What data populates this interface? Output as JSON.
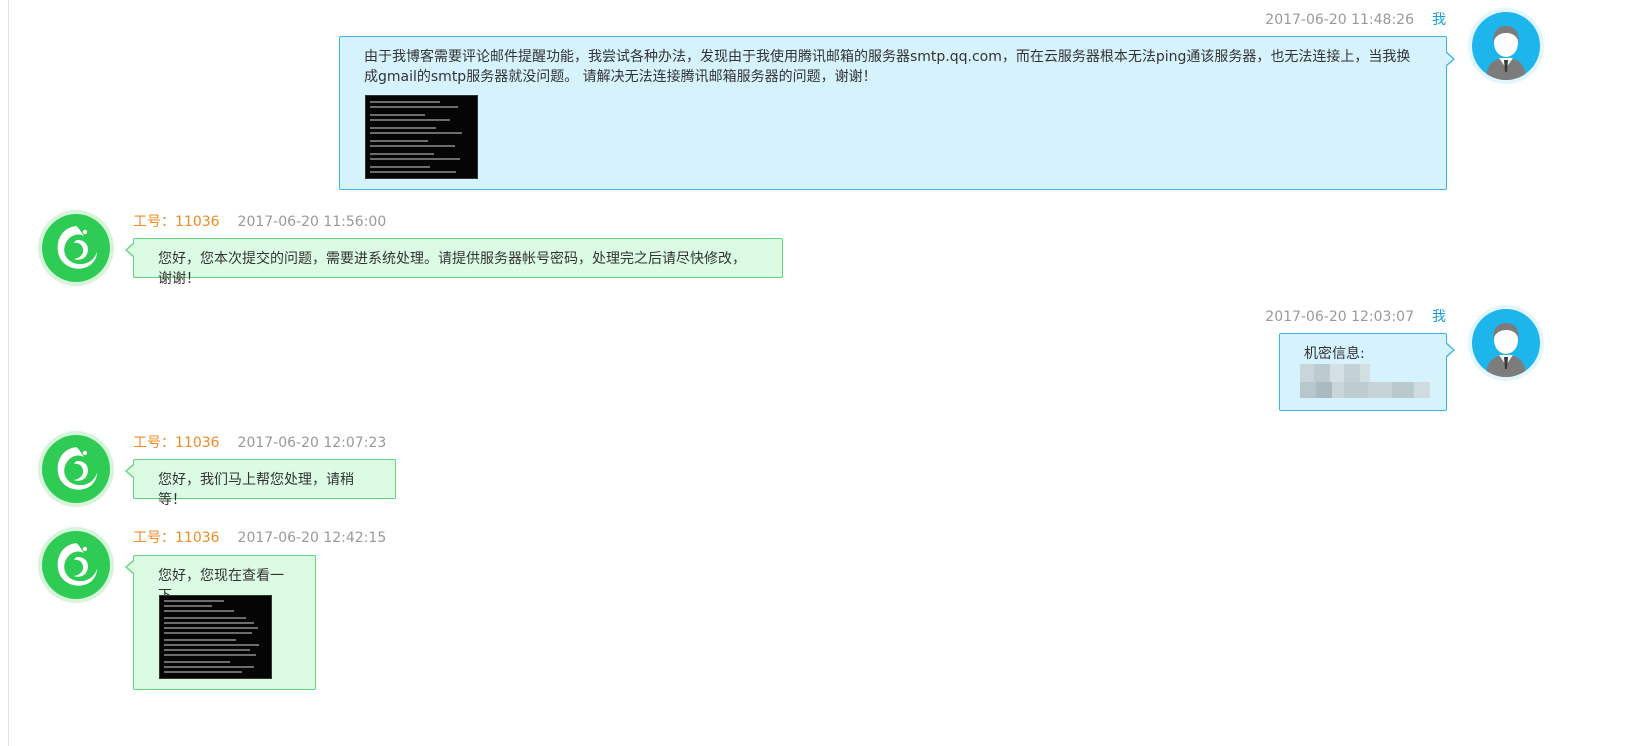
{
  "messages": [
    {
      "sender": "user",
      "timestamp": "2017-06-20 11:48:26",
      "me_label": "我",
      "text": "由于我博客需要评论邮件提醒功能，我尝试各种办法，发现由于我使用腾讯邮箱的服务器smtp.qq.com，而在云服务器根本无法ping通该服务器，也无法连接上，当我换成gmail的smtp服务器就没问题。 请解决无法连接腾讯邮箱服务器的问题，谢谢！",
      "attachment": "terminal-screenshot"
    },
    {
      "sender": "agent",
      "agent_label": "工号：11036",
      "timestamp": "2017-06-20 11:56:00",
      "text": "您好，您本次提交的问题，需要进系统处理。请提供服务器帐号密码，处理完之后请尽快修改，谢谢！"
    },
    {
      "sender": "user",
      "timestamp": "2017-06-20 12:03:07",
      "me_label": "我",
      "text": "机密信息:",
      "redacted": true
    },
    {
      "sender": "agent",
      "agent_label": "工号：11036",
      "timestamp": "2017-06-20 12:07:23",
      "text": "您好，我们马上帮您处理，请稍等！"
    },
    {
      "sender": "agent",
      "agent_label": "工号：11036",
      "timestamp": "2017-06-20 12:42:15",
      "text": "您好，您现在查看一下",
      "attachment": "terminal-screenshot"
    }
  ],
  "icons": {
    "user_avatar": "user-silhouette-icon",
    "agent_avatar": "phoenix-logo-icon"
  },
  "colors": {
    "user_bubble_bg": "#d6f3fd",
    "user_bubble_border": "#39b7e6",
    "agent_bubble_bg": "#dcfbe4",
    "agent_bubble_border": "#63d47d",
    "agent_id_color": "#f08a24",
    "me_label_color": "#1a9fd6",
    "timestamp_color": "#999999"
  }
}
